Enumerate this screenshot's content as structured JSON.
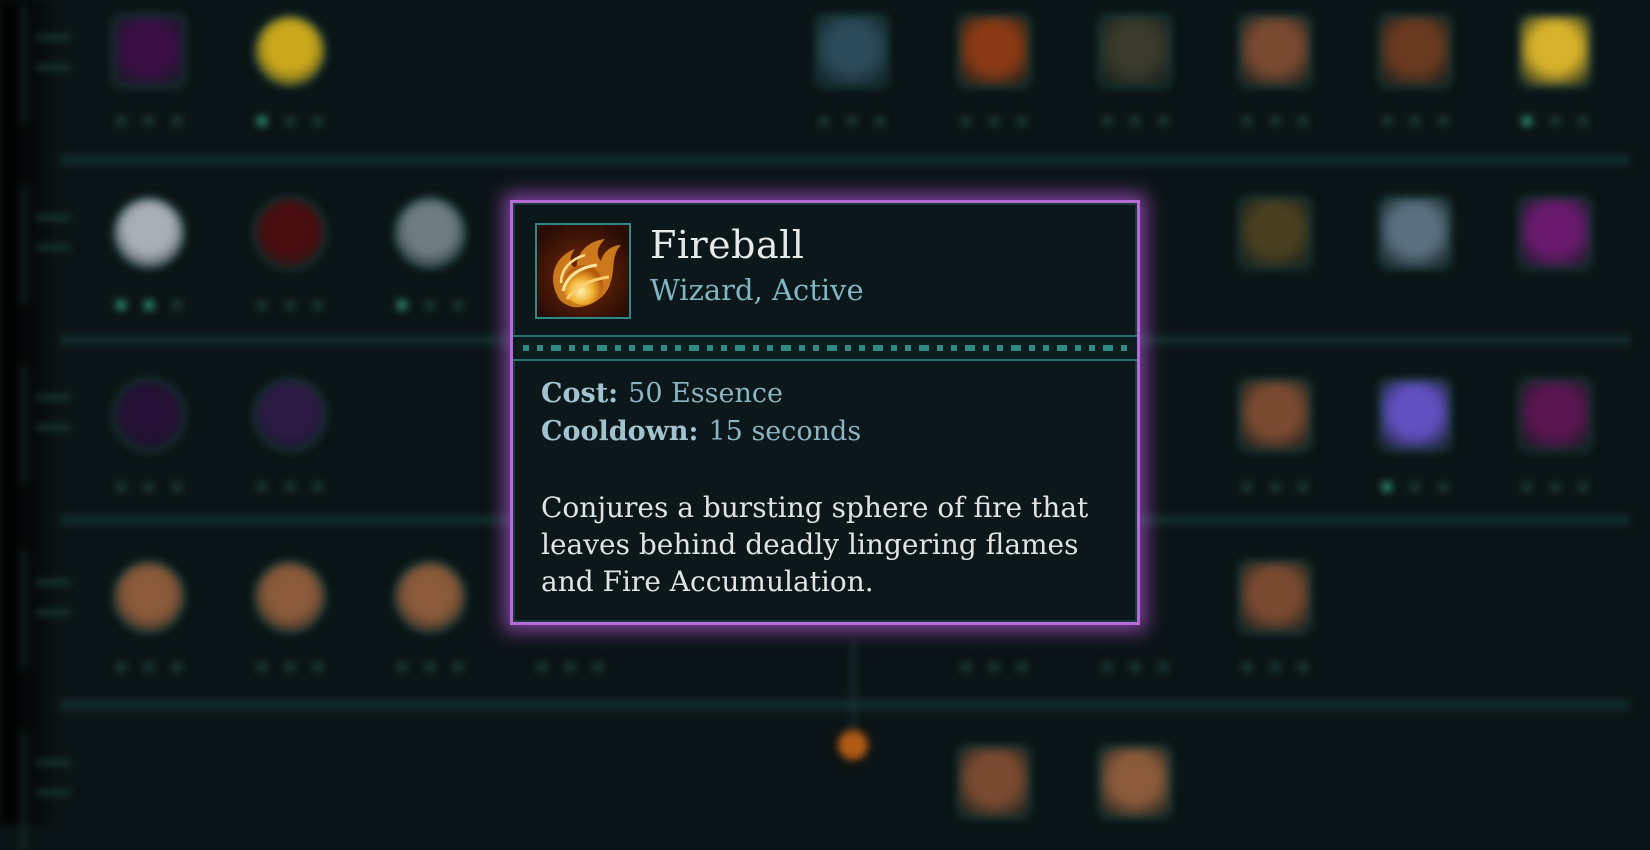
{
  "tooltip": {
    "name": "Fireball",
    "subtitle": "Wizard, Active",
    "icon": "fireball-icon",
    "stats": [
      {
        "label": "Cost:",
        "value": "50 Essence"
      },
      {
        "label": "Cooldown:",
        "value": "15 seconds"
      }
    ],
    "description": "Conjures a bursting sphere of fire that leaves behind deadly lingering flames and Fire Accumulation."
  },
  "colors": {
    "background": "#0b1416",
    "tooltip_border": "#b36bd6",
    "title": "#e6ebe8",
    "subtitle": "#7fb6c4"
  },
  "skill_tree": {
    "nodes": [
      {
        "icon": "shadow-rune-icon",
        "color": "#3b0f45"
      },
      {
        "icon": "golden-orb-icon",
        "color": "#c9a81c"
      },
      {
        "icon": "frost-shard-icon",
        "color": "#2b4b5a"
      },
      {
        "icon": "fire-wave-icon",
        "color": "#8a3a14"
      },
      {
        "icon": "arrow-volley-icon",
        "color": "#3a3a2a"
      },
      {
        "icon": "fist-strike-icon",
        "color": "#7a4a30"
      },
      {
        "icon": "blade-slash-icon",
        "color": "#6a3a20"
      },
      {
        "icon": "holy-light-icon",
        "color": "#d7b22a"
      },
      {
        "icon": "wolf-spirit-icon",
        "color": "#a8b0b4"
      },
      {
        "icon": "blood-orb-icon",
        "color": "#4a0d10"
      },
      {
        "icon": "storm-claw-icon",
        "color": "#6e7e80"
      },
      {
        "icon": "crossed-arrows-icon",
        "color": "#4a4020"
      },
      {
        "icon": "wind-swirl-icon",
        "color": "#5a7080"
      },
      {
        "icon": "arcane-burst-icon",
        "color": "#6a1a6e"
      },
      {
        "icon": "void-eye-icon",
        "color": "#241034"
      },
      {
        "icon": "dark-bolt-icon",
        "color": "#2c1a44"
      },
      {
        "icon": "ember-ring-icon",
        "color": "#7a4a30"
      },
      {
        "icon": "arcane-beam-icon",
        "color": "#6050c0"
      },
      {
        "icon": "corrupt-rune-icon",
        "color": "#5a1650"
      },
      {
        "icon": "earth-fist-icon",
        "color": "#8a5a3a"
      }
    ]
  }
}
